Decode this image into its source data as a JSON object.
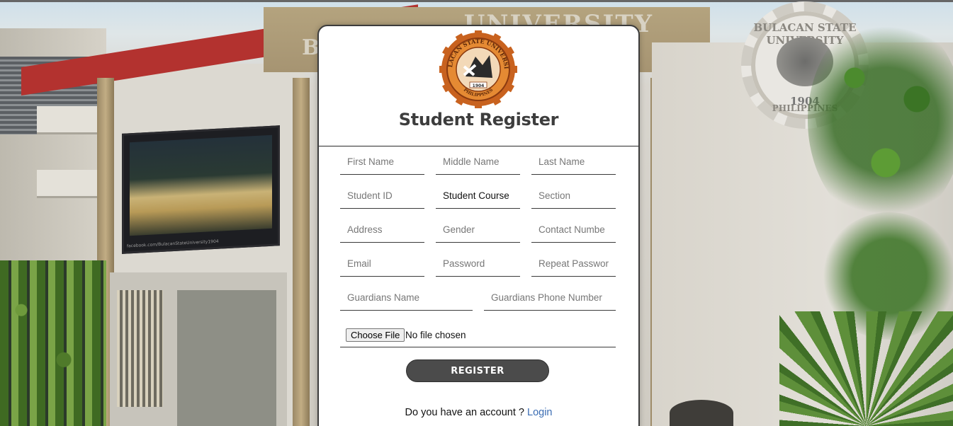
{
  "background": {
    "sign_text": "UNIVERSITY",
    "sign_initial": "B",
    "wall_seal_ring": "BULACAN STATE UNIVERSITY",
    "wall_seal_year": "1904",
    "wall_seal_country": "PHILIPPINES"
  },
  "card": {
    "title": "Student Register",
    "logo": {
      "icon": "university-seal-icon",
      "ring_text": "BULACAN STATE UNIVERSITY",
      "year": "1904",
      "country": "PHILIPPINES",
      "colors": {
        "ring": "#c8621f",
        "inner": "#e58a33",
        "core": "#2b2b2b"
      }
    },
    "fields": {
      "first_name": "First Name",
      "middle_name": "Middle Name",
      "last_name": "Last Name",
      "student_id": "Student ID",
      "student_course": "Student Course",
      "section": "Section",
      "address": "Address",
      "gender": "Gender",
      "contact_number": "Contact Numbe",
      "email": "Email",
      "password": "Password",
      "repeat_password": "Repeat Password",
      "guardians_name": "Guardians Name",
      "guardians_phone": "Guardians Phone Number"
    },
    "file_input": {
      "button": "Choose File",
      "status": "No file chosen"
    },
    "register_button": "REGISTER",
    "login_prompt": "Do you have an account ?",
    "login_link": "Login",
    "colors": {
      "link": "#3b6db3",
      "button": "#4b4b4b"
    }
  }
}
